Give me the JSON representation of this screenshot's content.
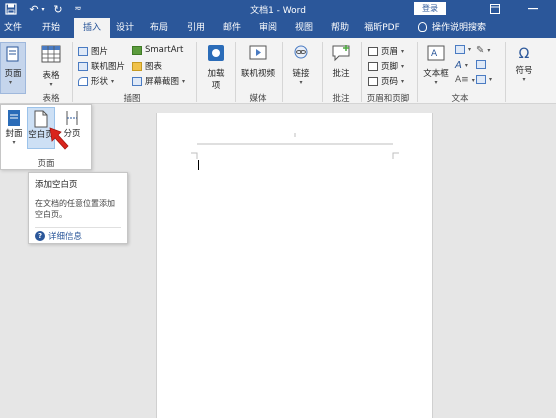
{
  "titlebar": {
    "title": "文档1 - Word",
    "login": "登录",
    "undo_symbol": "↶",
    "redo_symbol": "↻",
    "customize_symbol": "≂"
  },
  "tabs": [
    {
      "label": "文件"
    },
    {
      "label": "开始"
    },
    {
      "label": "插入",
      "active": true
    },
    {
      "label": "设计"
    },
    {
      "label": "布局"
    },
    {
      "label": "引用"
    },
    {
      "label": "邮件"
    },
    {
      "label": "审阅"
    },
    {
      "label": "视图"
    },
    {
      "label": "帮助"
    },
    {
      "label": "福昕PDF"
    },
    {
      "label": "操作说明搜索"
    }
  ],
  "ribbon": {
    "pages": {
      "label": "页面"
    },
    "table": {
      "label": "表格",
      "group": "表格"
    },
    "illustrations": {
      "group": "插图",
      "picture": "图片",
      "online_picture": "联机图片",
      "shapes": "形状",
      "smartart": "SmartArt",
      "chart": "图表",
      "screenshot": "屏幕截图"
    },
    "addins": {
      "line1": "加载",
      "line2": "项"
    },
    "media": {
      "online_video": "联机视频",
      "group": "媒体"
    },
    "links": {
      "label": "链接"
    },
    "comments": {
      "label": "批注",
      "group": "批注"
    },
    "header_footer": {
      "header": "页眉",
      "footer": "页脚",
      "page_number": "页码",
      "group": "页眉和页脚"
    },
    "text": {
      "textbox": "文本框",
      "group": "文本"
    },
    "symbols": {
      "label": "符号",
      "glyph": "Ω"
    }
  },
  "pages_dropdown": {
    "cover": "封面",
    "blank": "空白页",
    "page_break": "分页",
    "group": "页面"
  },
  "tooltip": {
    "title": "添加空白页",
    "description": "在文档的任意位置添加空白页。",
    "more_info": "详细信息",
    "help_glyph": "?"
  },
  "colors": {
    "brand": "#2b579a",
    "ribbon_bg": "#f3f3f3",
    "canvas_bg": "#e6e6e6",
    "arrow": "#d9241c"
  }
}
